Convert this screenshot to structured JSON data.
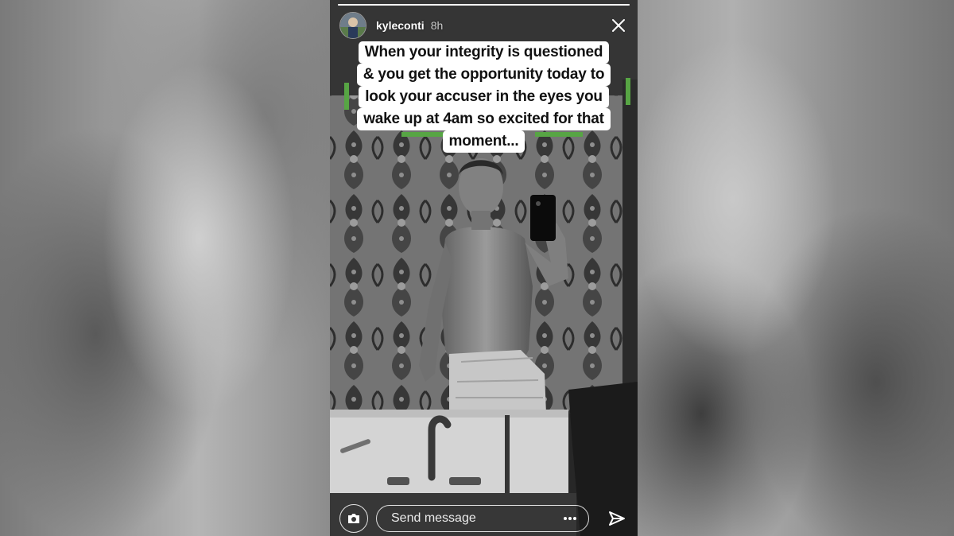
{
  "story": {
    "user": {
      "username": "kyleconti",
      "timestamp": "8h",
      "avatar_icon": "profile-avatar"
    },
    "progress": 1.0,
    "caption_lines": [
      "When your integrity is questioned",
      "& you get the opportunity today to",
      "look your accuser in the eyes you",
      "wake up at 4am so excited for that",
      "moment..."
    ],
    "footer": {
      "message_placeholder": "Send message",
      "camera_icon": "camera-icon",
      "more_icon": "more-options-icon",
      "send_icon": "send-icon"
    },
    "close_icon": "close-icon"
  },
  "colors": {
    "caption_bg": "#ffffff",
    "caption_text": "#111111",
    "accent_green": "#5fb34a"
  }
}
